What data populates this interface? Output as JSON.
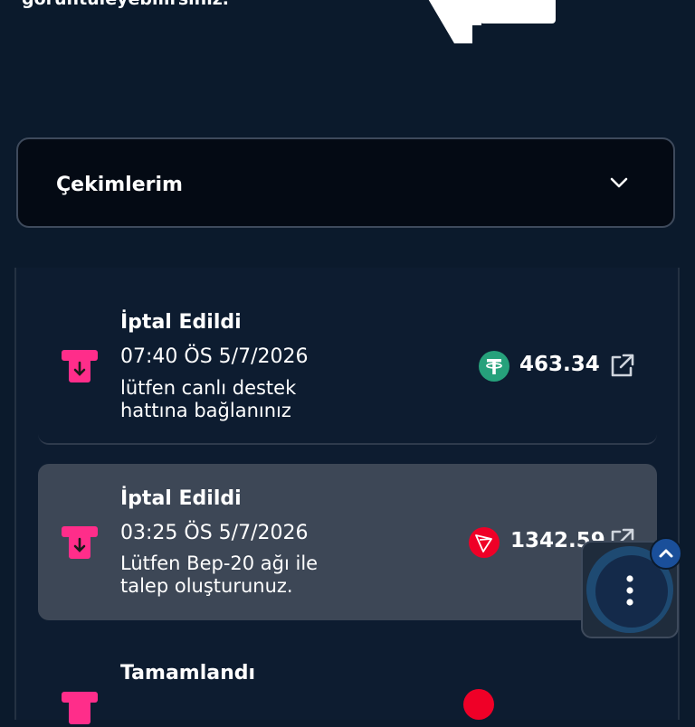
{
  "header": {
    "partial_text": "görüntüleyebilirsiniz."
  },
  "dropdown": {
    "label": "Çekimlerim"
  },
  "colors": {
    "background": "#0b1a2c",
    "card_highlight": "#3d4756",
    "atm_icon": "#ff2d8a",
    "usdt_green": "#26a17b",
    "tron_red": "#ef0027",
    "fab_accent": "#1a4f9a"
  },
  "withdrawals": [
    {
      "status": "İptal Edildi",
      "time": "07:40 ÖS 5/7/2026",
      "note_line1": "lütfen canlı destek",
      "note_line2": "hattına bağlanınız",
      "amount": "463.34",
      "coin_icon": "tether-icon"
    },
    {
      "status": "İptal Edildi",
      "time": "03:25 ÖS 5/7/2026",
      "note_line1": "Lütfen Bep-20 ağı ile",
      "note_line2": "talep oluşturunuz.",
      "amount": "1342.59",
      "coin_icon": "tron-icon"
    },
    {
      "status": "Tamamlandı",
      "coin_icon": "tron-icon"
    }
  ]
}
